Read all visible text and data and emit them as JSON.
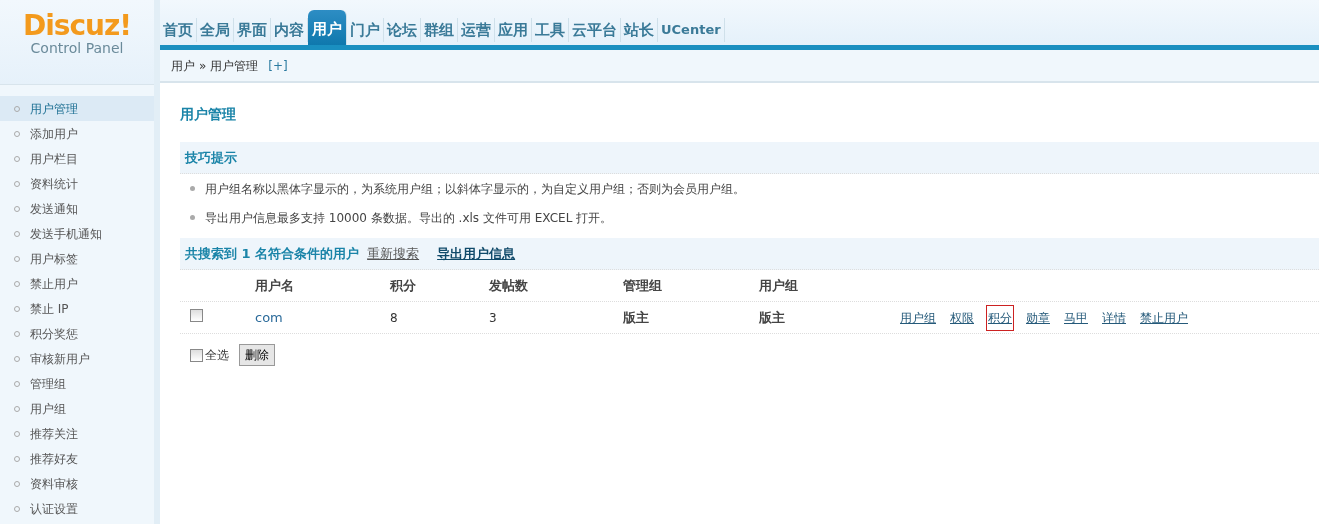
{
  "logo": {
    "brand": "Discuz!",
    "subtitle": "Control Panel"
  },
  "nav": [
    {
      "label": "首页",
      "selected": false
    },
    {
      "label": "全局",
      "selected": false
    },
    {
      "label": "界面",
      "selected": false
    },
    {
      "label": "内容",
      "selected": false
    },
    {
      "label": "用户",
      "selected": true
    },
    {
      "label": "门户",
      "selected": false
    },
    {
      "label": "论坛",
      "selected": false
    },
    {
      "label": "群组",
      "selected": false
    },
    {
      "label": "运营",
      "selected": false
    },
    {
      "label": "应用",
      "selected": false
    },
    {
      "label": "工具",
      "selected": false
    },
    {
      "label": "云平台",
      "selected": false
    },
    {
      "label": "站长",
      "selected": false
    },
    {
      "label": "UCenter",
      "selected": false
    }
  ],
  "breadcrumb": {
    "section": "用户",
    "separator": "»",
    "page": "用户管理",
    "add": "[+]"
  },
  "sidebar": {
    "items": [
      {
        "label": "用户管理",
        "selected": true
      },
      {
        "label": "添加用户",
        "selected": false
      },
      {
        "label": "用户栏目",
        "selected": false
      },
      {
        "label": "资料统计",
        "selected": false
      },
      {
        "label": "发送通知",
        "selected": false
      },
      {
        "label": "发送手机通知",
        "selected": false
      },
      {
        "label": "用户标签",
        "selected": false
      },
      {
        "label": "禁止用户",
        "selected": false
      },
      {
        "label": "禁止 IP",
        "selected": false
      },
      {
        "label": "积分奖惩",
        "selected": false
      },
      {
        "label": "审核新用户",
        "selected": false
      },
      {
        "label": "管理组",
        "selected": false
      },
      {
        "label": "用户组",
        "selected": false
      },
      {
        "label": "推荐关注",
        "selected": false
      },
      {
        "label": "推荐好友",
        "selected": false
      },
      {
        "label": "资料审核",
        "selected": false
      },
      {
        "label": "认证设置",
        "selected": false
      }
    ]
  },
  "page_title": "用户管理",
  "tips": {
    "title": "技巧提示",
    "items": [
      "用户组名称以黑体字显示的，为系统用户组；以斜体字显示的，为自定义用户组；否则为会员用户组。",
      "导出用户信息最多支持 10000 条数据。导出的 .xls 文件可用 EXCEL 打开。"
    ]
  },
  "results": {
    "summary": "共搜索到 1 名符合条件的用户",
    "research": "重新搜索",
    "export": "导出用户信息"
  },
  "table": {
    "columns": [
      "用户名",
      "积分",
      "发帖数",
      "管理组",
      "用户组"
    ],
    "rows": [
      {
        "checked": false,
        "username": "com",
        "credits": "8",
        "posts": "3",
        "admin_group": "版主",
        "user_group": "版主",
        "actions": [
          {
            "label": "用户组",
            "highlighted": false
          },
          {
            "label": "权限",
            "highlighted": false
          },
          {
            "label": "积分",
            "highlighted": true
          },
          {
            "label": "勋章",
            "highlighted": false
          },
          {
            "label": "马甲",
            "highlighted": false
          },
          {
            "label": "详情",
            "highlighted": false
          },
          {
            "label": "禁止用户",
            "highlighted": false
          }
        ]
      }
    ]
  },
  "footer": {
    "select_all": {
      "label": "全选",
      "checked": false
    },
    "delete_button": "删除"
  }
}
